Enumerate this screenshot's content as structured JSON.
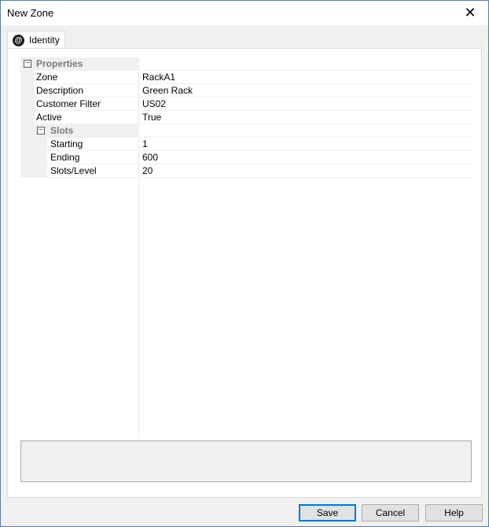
{
  "window": {
    "title": "New Zone"
  },
  "tabs": [
    {
      "label": "Identity"
    }
  ],
  "grid": {
    "categories": [
      {
        "label": "Properties",
        "rows": [
          {
            "name": "Zone",
            "value": "RackA1"
          },
          {
            "name": "Description",
            "value": "Green Rack"
          },
          {
            "name": "Customer Filter",
            "value": "US02"
          },
          {
            "name": "Active",
            "value": "True"
          }
        ]
      },
      {
        "label": "Slots",
        "rows": [
          {
            "name": "Starting",
            "value": "1"
          },
          {
            "name": "Ending",
            "value": "600"
          },
          {
            "name": "Slots/Level",
            "value": "20"
          }
        ]
      }
    ],
    "expander_glyph": "−"
  },
  "buttons": {
    "save": "Save",
    "cancel": "Cancel",
    "help": "Help"
  },
  "icons": {
    "close": "close-icon",
    "tab": "at-sign-icon"
  },
  "colors": {
    "accent": "#0078d7",
    "category_text": "#7a7a7a",
    "window_border": "#5a7da6"
  }
}
